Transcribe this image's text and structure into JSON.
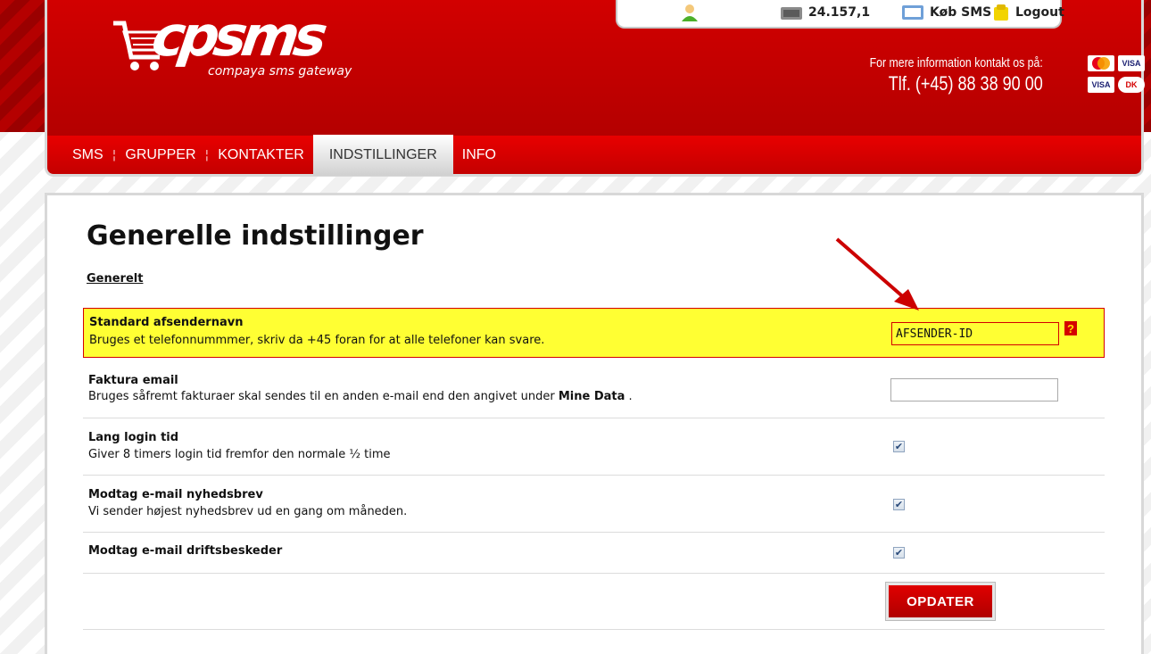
{
  "header": {
    "logo_text": "cpsms",
    "logo_subtitle": "compaya sms gateway",
    "balance": "24.157,1",
    "buy_sms_label": "Køb SMS",
    "logout_label": "Logout",
    "contact_line1": "For mere information kontakt os på:",
    "contact_phone": "Tlf. (+45) 88 38 90 00",
    "cards": [
      "MasterCard",
      "VISA",
      "VISA",
      "DK"
    ]
  },
  "nav": {
    "items": [
      {
        "label": "SMS"
      },
      {
        "label": "GRUPPER"
      },
      {
        "label": "KONTAKTER"
      },
      {
        "label": "INDSTILLINGER"
      },
      {
        "label": "INFO"
      }
    ],
    "active": "INDSTILLINGER"
  },
  "main": {
    "title": "Generelle indstillinger",
    "section": "Generelt",
    "rows": [
      {
        "title": "Standard afsendernavn",
        "description": "Bruges et telefonnummmer, skriv da +45 foran for at alle telefoner kan svare.",
        "input_value": "AFSENDER-ID",
        "help": "?"
      },
      {
        "title": "Faktura email",
        "description_prefix": "Bruges såfremt fakturaer skal sendes til en anden e-mail end den angivet under",
        "description_link": "Mine Data",
        "description_suffix": " .",
        "input_value": ""
      },
      {
        "title": "Lang login tid",
        "description": "Giver 8 timers login tid fremfor den normale ½ time",
        "checked": true
      },
      {
        "title": "Modtag e-mail nyhedsbrev",
        "description": "Vi sender højest nyhedsbrev ud en gang om måneden.",
        "checked": true
      },
      {
        "title": "Modtag e-mail driftsbeskeder",
        "checked": true
      }
    ],
    "submit_label": "OPDATER"
  },
  "colors": {
    "brand_red": "#c80000",
    "highlight_yellow": "#ffff33",
    "annotation_arrow": "#cc0000"
  },
  "icons": [
    "user-icon",
    "balance-icon",
    "buy-sms-icon",
    "logout-icon",
    "help-icon",
    "checkbox-checked-icon",
    "annotation-arrow-icon"
  ]
}
